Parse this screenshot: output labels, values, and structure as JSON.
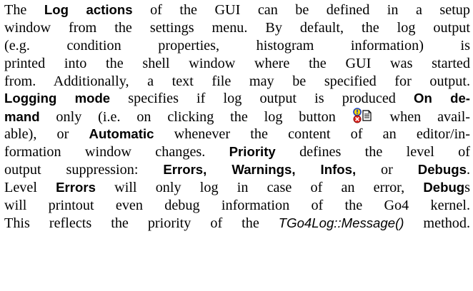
{
  "paragraph": {
    "l1": {
      "a": "The",
      "b": "Log actions",
      "c": "of the GUI can be defined in a setup"
    },
    "l2": "window from the settings menu. By default, the log output",
    "l3": "(e.g. condition properties, histogram information) is",
    "l4": "printed into the shell window where the GUI was started",
    "l5": "from. Additionally, a text file may be specified for output.",
    "l6": {
      "a": "Logging mode",
      "b": "specifies if log output is produced",
      "c": "On de-"
    },
    "l7": {
      "a": "mand",
      "b": "only (i.e. on clicking the log button",
      "c": "when avail-"
    },
    "l8": {
      "a": "able), or",
      "b": "Automatic",
      "c": "whenever the content of an editor/in-"
    },
    "l9": {
      "a": "formation window changes.",
      "b": "Priority",
      "c": "defines the level of"
    },
    "l10": {
      "a": "output suppression:",
      "b": "Errors, Warnings, Infos,",
      "c": "or",
      "d": "Debugs",
      "e": "."
    },
    "l11": {
      "a": "Level",
      "b": "Errors",
      "c": "will only log in case of an error,",
      "d": "Debug",
      "e": "s"
    },
    "l12": "will printout even debug information of the Go4 kernel.",
    "l13": {
      "a": "This reflects the priority of the",
      "b": "TGo4Log::Message()",
      "c": "method."
    }
  },
  "icons": {
    "log_button": "log-button-icon"
  },
  "colors": {
    "text": "#000000",
    "icon_yellow": "#f5d400",
    "icon_blue": "#1a3fc7",
    "icon_red": "#e0201a"
  }
}
